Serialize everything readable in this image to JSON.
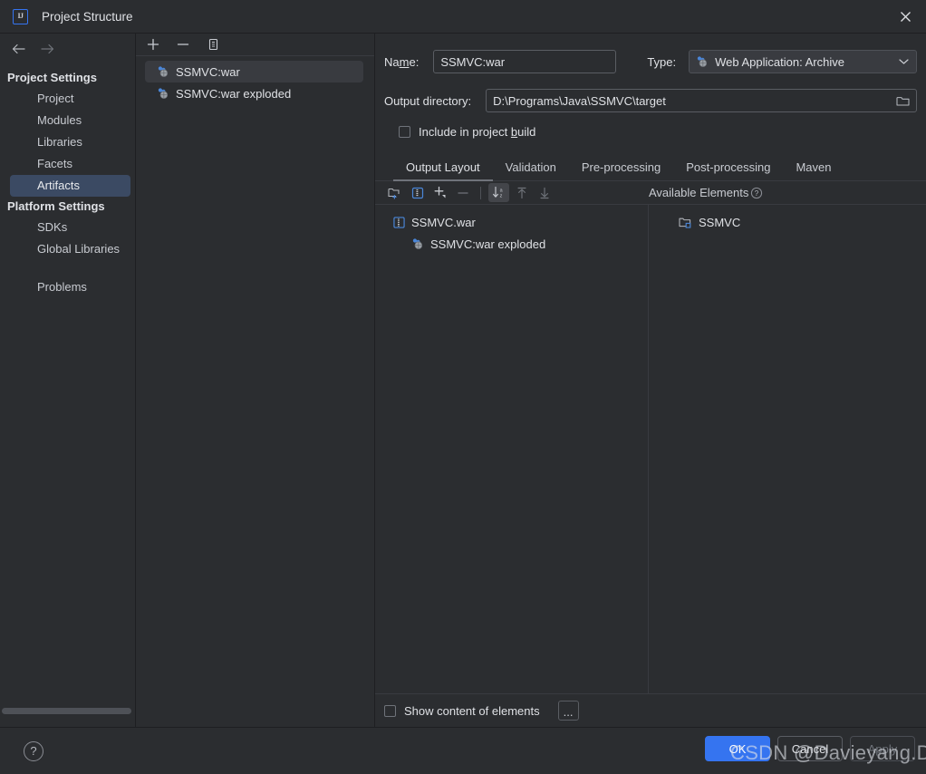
{
  "window": {
    "title": "Project Structure",
    "app_icon": "intellij-idea-icon",
    "close_icon": "close-icon"
  },
  "sidebar": {
    "back_icon": "arrow-left-icon",
    "forward_icon": "arrow-right-icon",
    "groups": [
      {
        "label": "Project Settings",
        "items": [
          {
            "label": "Project",
            "selected": false
          },
          {
            "label": "Modules",
            "selected": false
          },
          {
            "label": "Libraries",
            "selected": false
          },
          {
            "label": "Facets",
            "selected": false
          },
          {
            "label": "Artifacts",
            "selected": true
          }
        ]
      },
      {
        "label": "Platform Settings",
        "items": [
          {
            "label": "SDKs",
            "selected": false
          },
          {
            "label": "Global Libraries",
            "selected": false
          }
        ]
      }
    ],
    "problems": {
      "label": "Problems",
      "selected": false
    }
  },
  "artifacts_panel": {
    "toolbar": {
      "add_label": "+",
      "remove_label": "−",
      "copy_icon": "copy-icon"
    },
    "items": [
      {
        "label": "SSMVC:war",
        "icon": "artifact-icon",
        "selected": true
      },
      {
        "label": "SSMVC:war exploded",
        "icon": "artifact-icon",
        "selected": false
      }
    ]
  },
  "detail": {
    "name_label_pre": "Na",
    "name_label_mnemonic": "m",
    "name_label_post": "e:",
    "name_value": "SSMVC:war",
    "type_label": "Type:",
    "type_value": "Web Application: Archive",
    "type_icon": "artifact-icon",
    "type_chevron": "chevron-down-icon",
    "output_label": "Output directory:",
    "output_value": "D:\\Programs\\Java\\SSMVC\\target",
    "output_browse_icon": "folder-icon",
    "include_checkbox_pre": "Include in project ",
    "include_checkbox_mnemonic": "b",
    "include_checkbox_post": "uild",
    "include_checked": false,
    "tabs": [
      {
        "label": "Output Layout",
        "active": true
      },
      {
        "label": "Validation",
        "active": false
      },
      {
        "label": "Pre-processing",
        "active": false
      },
      {
        "label": "Post-processing",
        "active": false
      },
      {
        "label": "Maven",
        "active": false
      }
    ],
    "layout_toolbar": {
      "new_directory_icon": "new-folder-icon",
      "new_archive_icon": "new-archive-icon",
      "add_icon": "add-dropdown-icon",
      "remove_icon": "minus-icon",
      "sort_icon": "sort-alphabetically-icon",
      "move_up_icon": "arrow-up-icon",
      "move_down_icon": "arrow-down-icon"
    },
    "available_elements": {
      "label": "Available Elements",
      "help_icon": "help-circle-icon"
    },
    "output_tree": [
      {
        "label": "SSMVC.war",
        "icon": "archive-icon",
        "level": 0
      },
      {
        "label": "SSMVC:war exploded",
        "icon": "artifact-icon",
        "level": 1
      }
    ],
    "available_tree": [
      {
        "label": "SSMVC",
        "icon": "module-folder-icon",
        "level": 0
      }
    ],
    "show_content_label": "Show content of elements",
    "show_content_checked": false,
    "more_button_label": "..."
  },
  "footer": {
    "help_icon": "help-circle-icon",
    "help_label": "?",
    "buttons": [
      {
        "label": "OK",
        "style": "default"
      },
      {
        "label": "Cancel",
        "style": "plain"
      },
      {
        "label": "Apply",
        "style": "plain-disabled"
      }
    ]
  },
  "watermark": {
    "text": "CSDN @Davieyang.D.Y"
  },
  "colors": {
    "background": "#2b2d30",
    "panel_border": "#1e1f22",
    "selection_blue": "#3b4a63",
    "accent_blue": "#3574f0",
    "icon_blue": "#4a86d8",
    "text_primary": "#dfe1e5",
    "text_secondary": "#c8cbd1"
  }
}
